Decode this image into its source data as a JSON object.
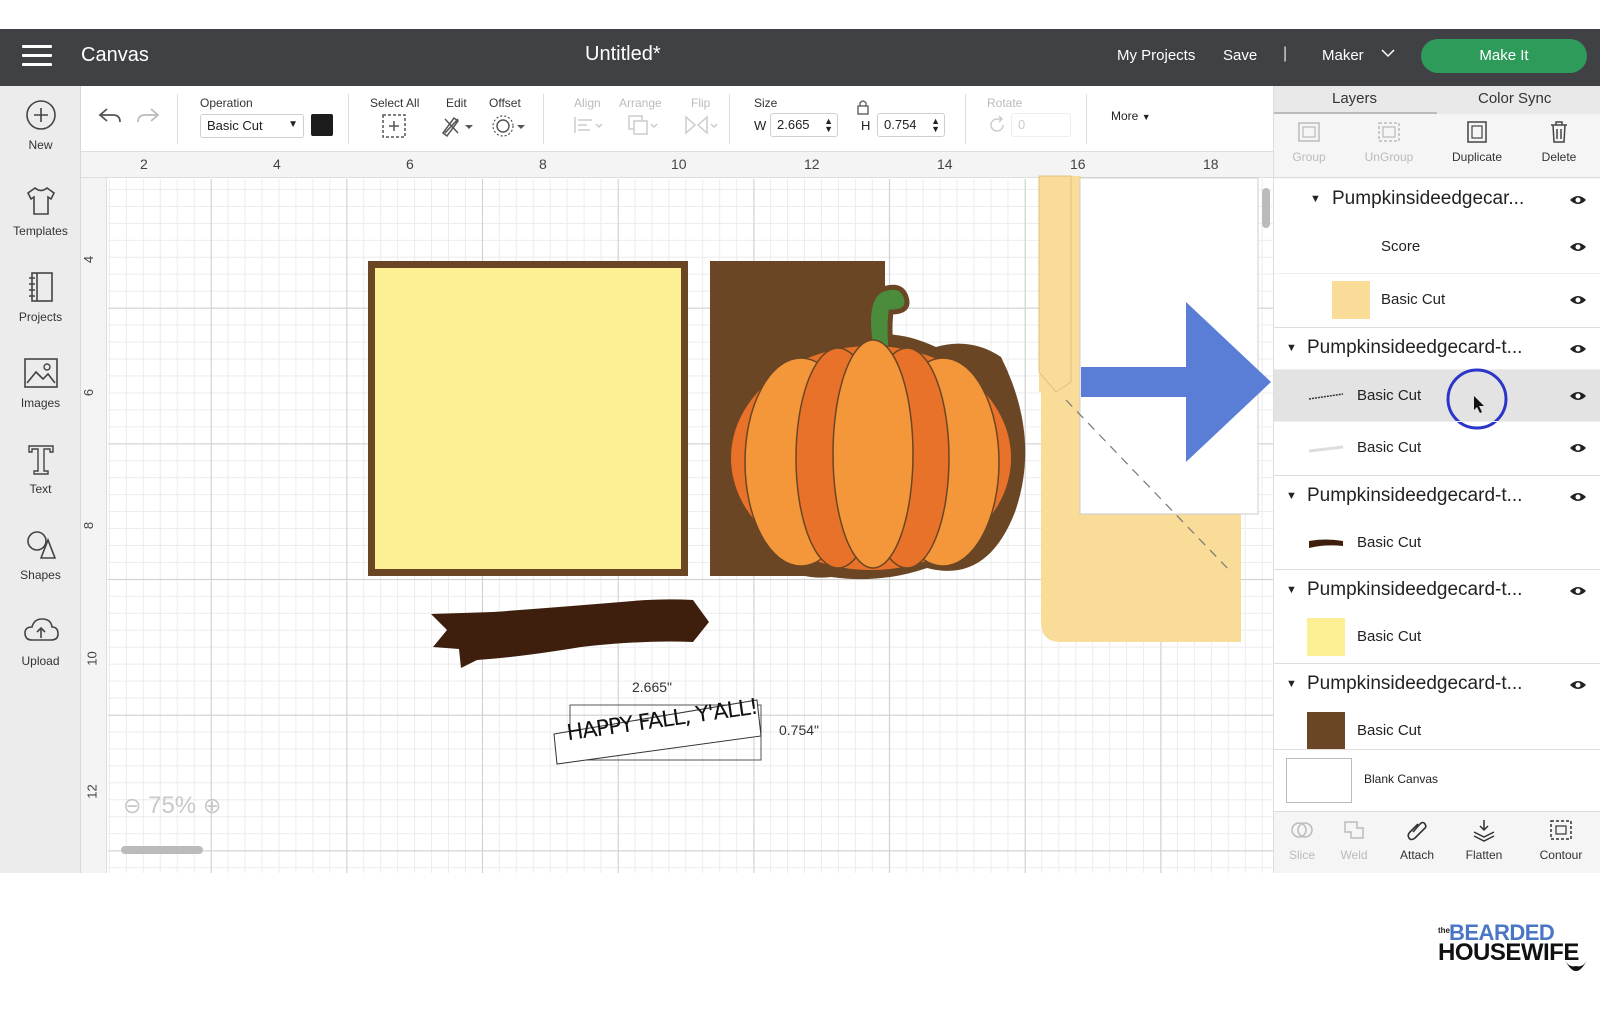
{
  "topbar": {
    "app_title": "Canvas",
    "doc_title": "Untitled*",
    "my_projects": "My Projects",
    "save": "Save",
    "separator": "|",
    "machine": "Maker",
    "make_it": "Make It",
    "accent_color": "#2f9b5b"
  },
  "leftbar": {
    "items": [
      {
        "label": "New",
        "icon": "plus-circle-icon"
      },
      {
        "label": "Templates",
        "icon": "tshirt-icon"
      },
      {
        "label": "Projects",
        "icon": "notebook-icon"
      },
      {
        "label": "Images",
        "icon": "image-icon"
      },
      {
        "label": "Text",
        "icon": "text-icon"
      },
      {
        "label": "Shapes",
        "icon": "shapes-icon"
      },
      {
        "label": "Upload",
        "icon": "cloud-upload-icon"
      }
    ]
  },
  "toolbar": {
    "operation_label": "Operation",
    "operation_value": "Basic Cut",
    "select_all": "Select All",
    "edit": "Edit",
    "offset": "Offset",
    "align": "Align",
    "arrange": "Arrange",
    "flip": "Flip",
    "size_label": "Size",
    "w_label": "W",
    "w_value": "2.665",
    "h_label": "H",
    "h_value": "0.754",
    "rotate_label": "Rotate",
    "rotate_value": "0",
    "more": "More"
  },
  "canvas": {
    "ruler_top": [
      "2",
      "4",
      "6",
      "8",
      "10",
      "12",
      "14",
      "16",
      "18"
    ],
    "ruler_left": [
      "4",
      "6",
      "8",
      "10",
      "12"
    ],
    "zoom": "75%",
    "banner_text": "HAPPY FALL, Y'ALL!",
    "width_dim": "2.665\"",
    "height_dim": "0.754\"",
    "colors": {
      "yellow": "#fdf094",
      "brown": "#6b4624",
      "dark_brown": "#3e1f0e",
      "orange": "#f3973a",
      "stem_green": "#4a8c3b",
      "card_tan": "#f9dc98",
      "arrow_blue": "#5a7ed6"
    }
  },
  "right_panel": {
    "tabs": [
      "Layers",
      "Color Sync"
    ],
    "actions": [
      "Group",
      "UnGroup",
      "Duplicate",
      "Delete"
    ],
    "layers": [
      {
        "group": "Pumpkinsideedgecar...",
        "items": [
          {
            "name": "Score",
            "swatch": "#ffffff"
          },
          {
            "name": "Basic Cut",
            "swatch": "#f9dc98"
          }
        ]
      },
      {
        "group": "Pumpkinsideedgecard-t...",
        "items": [
          {
            "name": "Basic Cut",
            "swatch": "#ffffff"
          },
          {
            "name": "Basic Cut",
            "swatch": "#ffffff"
          }
        ]
      },
      {
        "group": "Pumpkinsideedgecard-t...",
        "items": [
          {
            "name": "Basic Cut",
            "swatch": "#3e1f0e"
          }
        ]
      },
      {
        "group": "Pumpkinsideedgecard-t...",
        "items": [
          {
            "name": "Basic Cut",
            "swatch": "#fdf094"
          }
        ]
      },
      {
        "group": "Pumpkinsideedgecard-t...",
        "items": [
          {
            "name": "Basic Cut",
            "swatch": "#6b4624"
          }
        ]
      }
    ],
    "blank_canvas": "Blank Canvas",
    "bottom_actions": [
      "Slice",
      "Weld",
      "Attach",
      "Flatten",
      "Contour"
    ]
  },
  "watermark": {
    "line1_small": "the",
    "line1": "BEARDED",
    "line2": "HOUSEWIFE"
  }
}
